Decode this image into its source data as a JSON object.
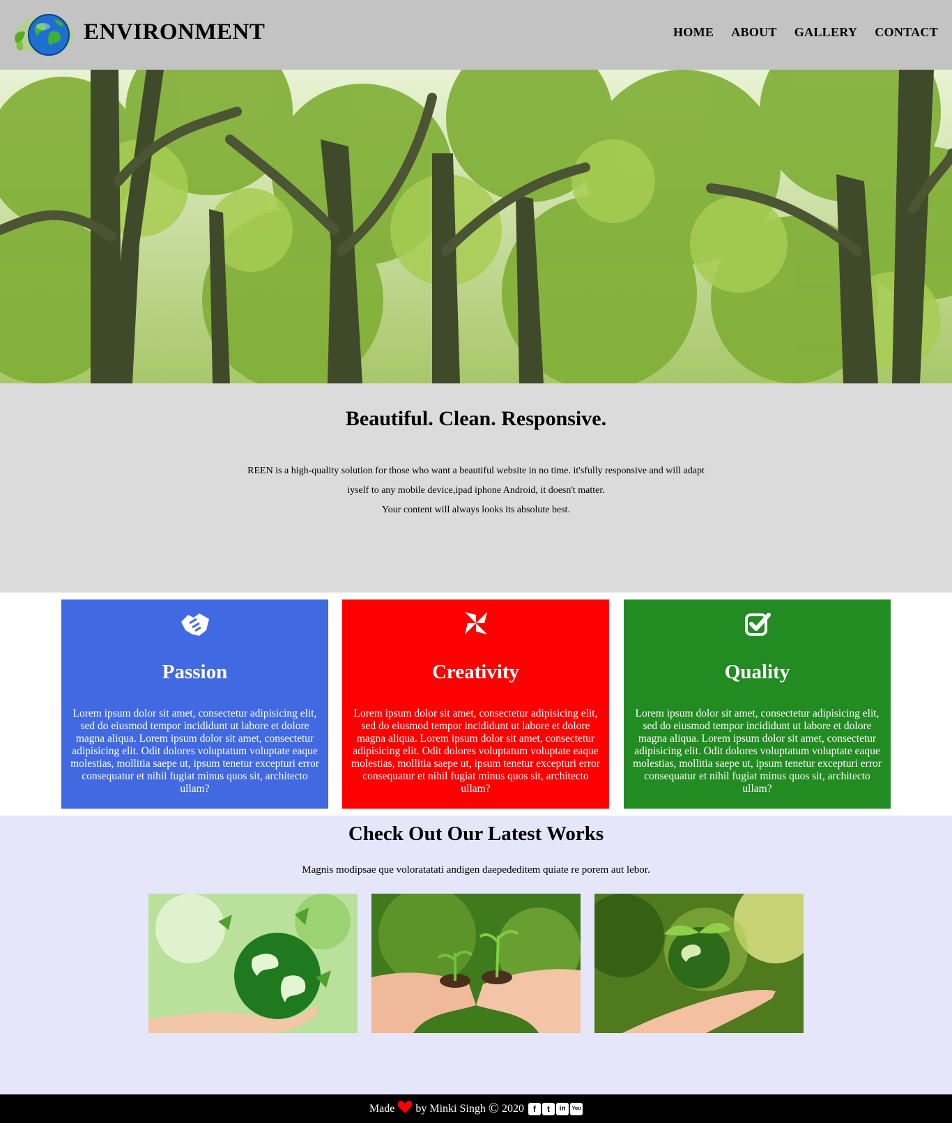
{
  "header": {
    "brand": "ENVIRONMENT",
    "logo_icon": "earth-globe-leaf-icon",
    "nav": [
      "HOME",
      "ABOUT",
      "GALLERY",
      "CONTACT"
    ]
  },
  "intro": {
    "title": "Beautiful. Clean. Responsive.",
    "lines": [
      "REEN is a high-quality solution for those who want a beautiful website in no time. it'sfully responsive and will adapt",
      "iyself to any mobile device,ipad iphone Android, it doesn't matter.",
      "Your content will always looks its absolute best."
    ]
  },
  "features": [
    {
      "title": "Passion",
      "icon": "handshake-icon",
      "color": "#4169e1",
      "text": "Lorem ipsum dolor sit amet, consectetur adipisicing elit, sed do eiusmod tempor incididunt ut labore et dolore magna aliqua. Lorem ipsum dolor sit amet, consectetur adipisicing elit. Odit dolores voluptatum voluptate eaque molestias, mollitia saepe ut, ipsum tenetur excepturi error consequatur et nihil fugiat minus quos sit, architecto ullam?"
    },
    {
      "title": "Creativity",
      "icon": "pinwheel-icon",
      "color": "#ff0000",
      "text": "Lorem ipsum dolor sit amet, consectetur adipisicing elit, sed do eiusmod tempor incididunt ut labore et dolore magna aliqua. Lorem ipsum dolor sit amet, consectetur adipisicing elit. Odit dolores voluptatum voluptate eaque molestias, mollitia saepe ut, ipsum tenetur excepturi error consequatur et nihil fugiat minus quos sit, architecto ullam?"
    },
    {
      "title": "Quality",
      "icon": "check-square-icon",
      "color": "#228b22",
      "text": "Lorem ipsum dolor sit amet, consectetur adipisicing elit, sed do eiusmod tempor incididunt ut labore et dolore magna aliqua. Lorem ipsum dolor sit amet, consectetur adipisicing elit. Odit dolores voluptatum voluptate eaque molestias, mollitia saepe ut, ipsum tenetur excepturi error consequatur et nihil fugiat minus quos sit, architecto ullam?"
    }
  ],
  "works": {
    "title": "Check Out Our Latest Works",
    "subtitle": "Magnis modipsae que voloratatati andigen daepededitem quiate re porem aut lebor."
  },
  "footer": {
    "made": "Made",
    "by": "by Minki Singh",
    "year": "2020",
    "heart_icon": "heart-icon",
    "copyright_symbol": "©",
    "social": [
      "facebook-icon",
      "twitter-icon",
      "linkedin-icon",
      "youtube-icon"
    ],
    "social_glyphs": [
      "f",
      "t",
      "in",
      "You"
    ]
  }
}
